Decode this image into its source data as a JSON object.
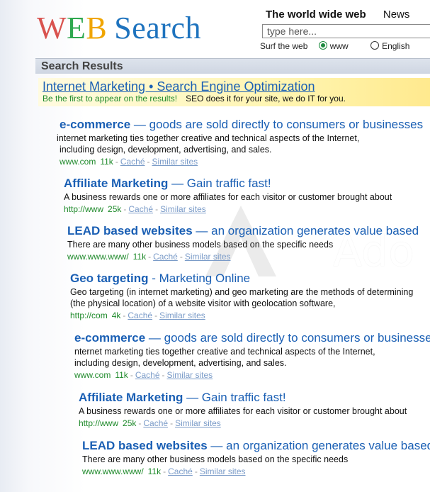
{
  "logo": {
    "w": "W",
    "e": "E",
    "b": "B",
    "rest": "Search"
  },
  "topnav": {
    "active": "The world wide web",
    "news": "News"
  },
  "search": {
    "placeholder": "type here..."
  },
  "surf": {
    "label": "Surf the web",
    "opt1": "www",
    "opt2": "English"
  },
  "results_header": "Search Results",
  "ad": {
    "title": "Internet Marketing • Search Engine Optimization",
    "line_green": "Be the first to appear on the results!",
    "line_black": "SEO does it for your site, we do IT for you."
  },
  "results": [
    {
      "title_strong": "e-commerce",
      "title_rest": " — goods are sold directly to consumers or businesses",
      "desc": [
        "internet marketing ties together creative and technical aspects of the Internet,",
        "including design, development, advertising, and sales."
      ],
      "url": "www.com",
      "size": "11k",
      "cache": "Caché",
      "similar": "Similar sites"
    },
    {
      "title_strong": "Affiliate Marketing",
      "title_rest": " — Gain traffic fast!",
      "desc": [
        "A business rewards one or more affiliates for each visitor or customer brought about"
      ],
      "url": "http://www",
      "size": "25k",
      "cache": "Caché",
      "similar": "Similar sites"
    },
    {
      "title_strong": "LEAD based websites",
      "title_rest": " — an organization generates value based",
      "desc": [
        "There are many other business models based on the specific needs"
      ],
      "url": "www.www.www/",
      "size": "11k",
      "cache": "Caché",
      "similar": "Similar sites"
    },
    {
      "title_strong": "Geo targeting",
      "title_rest": " - Marketing Online",
      "desc": [
        "Geo targeting (in internet marketing) and geo marketing are the methods of determining",
        "(the physical location) of a website visitor with geolocation software,"
      ],
      "url": "http://com",
      "size": "4k",
      "cache": "Caché",
      "similar": "Similar sites"
    },
    {
      "title_strong": "e-commerce",
      "title_rest": " — goods are sold directly to consumers or businesses",
      "desc": [
        "nternet marketing ties together creative and technical aspects of the Internet,",
        "including design, development, advertising, and sales."
      ],
      "url": "www.com",
      "size": "11k",
      "cache": "Caché",
      "similar": "Similar sites"
    },
    {
      "title_strong": "Affiliate Marketing",
      "title_rest": " — Gain traffic fast!",
      "desc": [
        "A business rewards one or more affiliates for each visitor or customer brought about"
      ],
      "url": "http://www",
      "size": "25k",
      "cache": "Caché",
      "similar": "Similar sites"
    },
    {
      "title_strong": "LEAD based websites",
      "title_rest": " — an organization generates value based",
      "desc": [
        "There are many other business models based on the specific needs"
      ],
      "url": "www.www.www/",
      "size": "11k",
      "cache": "Caché",
      "similar": "Similar sites"
    }
  ],
  "watermark": "Ado"
}
